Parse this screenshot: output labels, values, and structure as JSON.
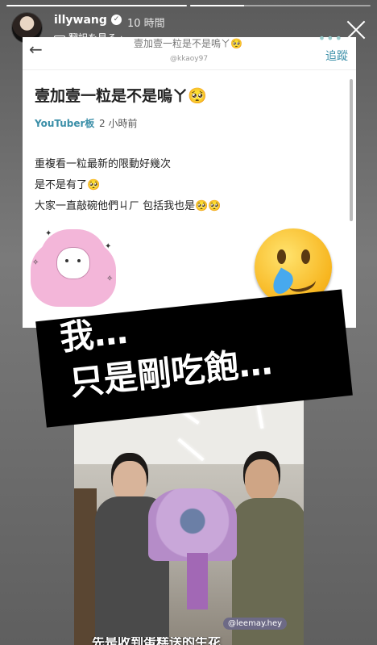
{
  "story": {
    "progress": [
      1.0,
      0.3
    ],
    "username": "illywang",
    "verified_icon": "verified-badge-icon",
    "time_ago": "10 時間",
    "translate_label": "翻訳を見る",
    "translate_chevron": "›",
    "close_icon": "close-icon"
  },
  "post": {
    "topbar_ghost_text": "壹加壹一粒是不是嗚ㄚ🥺",
    "watermark": "@kkaoy97",
    "follow_label": "追蹤",
    "title": "壹加壹一粒是不是嗚ㄚ🥺",
    "board": "YouTuber板",
    "posted_ago": "2 小時前",
    "body": [
      "重複看一粒最新的限動好幾次",
      "是不是有了🥺",
      "大家一直敲碗他們ㄐㄏ 包括我也是🥺🥺"
    ]
  },
  "overlay": {
    "caption_line1": "我…",
    "caption_line2": "只是剛吃飽…",
    "emoji": "crying-smile-emoji"
  },
  "photo": {
    "handle_tag": "@leemay.hey",
    "subtitle": "先是收到蛋糕送的生花"
  }
}
